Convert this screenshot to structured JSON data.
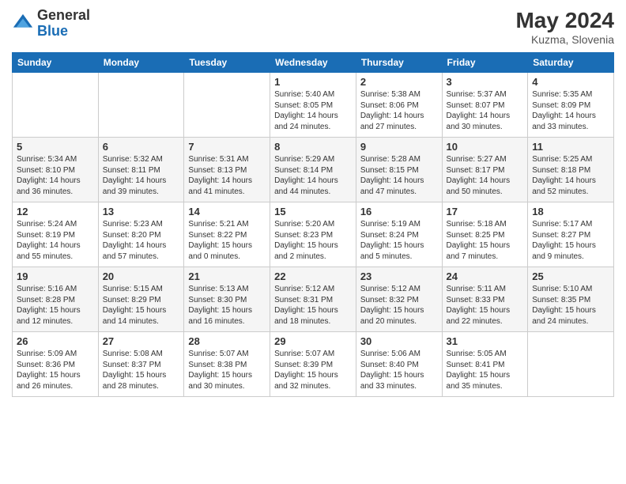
{
  "header": {
    "logo_general": "General",
    "logo_blue": "Blue",
    "month_year": "May 2024",
    "location": "Kuzma, Slovenia"
  },
  "weekdays": [
    "Sunday",
    "Monday",
    "Tuesday",
    "Wednesday",
    "Thursday",
    "Friday",
    "Saturday"
  ],
  "weeks": [
    [
      {
        "day": "",
        "info": ""
      },
      {
        "day": "",
        "info": ""
      },
      {
        "day": "",
        "info": ""
      },
      {
        "day": "1",
        "info": "Sunrise: 5:40 AM\nSunset: 8:05 PM\nDaylight: 14 hours and 24 minutes."
      },
      {
        "day": "2",
        "info": "Sunrise: 5:38 AM\nSunset: 8:06 PM\nDaylight: 14 hours and 27 minutes."
      },
      {
        "day": "3",
        "info": "Sunrise: 5:37 AM\nSunset: 8:07 PM\nDaylight: 14 hours and 30 minutes."
      },
      {
        "day": "4",
        "info": "Sunrise: 5:35 AM\nSunset: 8:09 PM\nDaylight: 14 hours and 33 minutes."
      }
    ],
    [
      {
        "day": "5",
        "info": "Sunrise: 5:34 AM\nSunset: 8:10 PM\nDaylight: 14 hours and 36 minutes."
      },
      {
        "day": "6",
        "info": "Sunrise: 5:32 AM\nSunset: 8:11 PM\nDaylight: 14 hours and 39 minutes."
      },
      {
        "day": "7",
        "info": "Sunrise: 5:31 AM\nSunset: 8:13 PM\nDaylight: 14 hours and 41 minutes."
      },
      {
        "day": "8",
        "info": "Sunrise: 5:29 AM\nSunset: 8:14 PM\nDaylight: 14 hours and 44 minutes."
      },
      {
        "day": "9",
        "info": "Sunrise: 5:28 AM\nSunset: 8:15 PM\nDaylight: 14 hours and 47 minutes."
      },
      {
        "day": "10",
        "info": "Sunrise: 5:27 AM\nSunset: 8:17 PM\nDaylight: 14 hours and 50 minutes."
      },
      {
        "day": "11",
        "info": "Sunrise: 5:25 AM\nSunset: 8:18 PM\nDaylight: 14 hours and 52 minutes."
      }
    ],
    [
      {
        "day": "12",
        "info": "Sunrise: 5:24 AM\nSunset: 8:19 PM\nDaylight: 14 hours and 55 minutes."
      },
      {
        "day": "13",
        "info": "Sunrise: 5:23 AM\nSunset: 8:20 PM\nDaylight: 14 hours and 57 minutes."
      },
      {
        "day": "14",
        "info": "Sunrise: 5:21 AM\nSunset: 8:22 PM\nDaylight: 15 hours and 0 minutes."
      },
      {
        "day": "15",
        "info": "Sunrise: 5:20 AM\nSunset: 8:23 PM\nDaylight: 15 hours and 2 minutes."
      },
      {
        "day": "16",
        "info": "Sunrise: 5:19 AM\nSunset: 8:24 PM\nDaylight: 15 hours and 5 minutes."
      },
      {
        "day": "17",
        "info": "Sunrise: 5:18 AM\nSunset: 8:25 PM\nDaylight: 15 hours and 7 minutes."
      },
      {
        "day": "18",
        "info": "Sunrise: 5:17 AM\nSunset: 8:27 PM\nDaylight: 15 hours and 9 minutes."
      }
    ],
    [
      {
        "day": "19",
        "info": "Sunrise: 5:16 AM\nSunset: 8:28 PM\nDaylight: 15 hours and 12 minutes."
      },
      {
        "day": "20",
        "info": "Sunrise: 5:15 AM\nSunset: 8:29 PM\nDaylight: 15 hours and 14 minutes."
      },
      {
        "day": "21",
        "info": "Sunrise: 5:13 AM\nSunset: 8:30 PM\nDaylight: 15 hours and 16 minutes."
      },
      {
        "day": "22",
        "info": "Sunrise: 5:12 AM\nSunset: 8:31 PM\nDaylight: 15 hours and 18 minutes."
      },
      {
        "day": "23",
        "info": "Sunrise: 5:12 AM\nSunset: 8:32 PM\nDaylight: 15 hours and 20 minutes."
      },
      {
        "day": "24",
        "info": "Sunrise: 5:11 AM\nSunset: 8:33 PM\nDaylight: 15 hours and 22 minutes."
      },
      {
        "day": "25",
        "info": "Sunrise: 5:10 AM\nSunset: 8:35 PM\nDaylight: 15 hours and 24 minutes."
      }
    ],
    [
      {
        "day": "26",
        "info": "Sunrise: 5:09 AM\nSunset: 8:36 PM\nDaylight: 15 hours and 26 minutes."
      },
      {
        "day": "27",
        "info": "Sunrise: 5:08 AM\nSunset: 8:37 PM\nDaylight: 15 hours and 28 minutes."
      },
      {
        "day": "28",
        "info": "Sunrise: 5:07 AM\nSunset: 8:38 PM\nDaylight: 15 hours and 30 minutes."
      },
      {
        "day": "29",
        "info": "Sunrise: 5:07 AM\nSunset: 8:39 PM\nDaylight: 15 hours and 32 minutes."
      },
      {
        "day": "30",
        "info": "Sunrise: 5:06 AM\nSunset: 8:40 PM\nDaylight: 15 hours and 33 minutes."
      },
      {
        "day": "31",
        "info": "Sunrise: 5:05 AM\nSunset: 8:41 PM\nDaylight: 15 hours and 35 minutes."
      },
      {
        "day": "",
        "info": ""
      }
    ]
  ]
}
